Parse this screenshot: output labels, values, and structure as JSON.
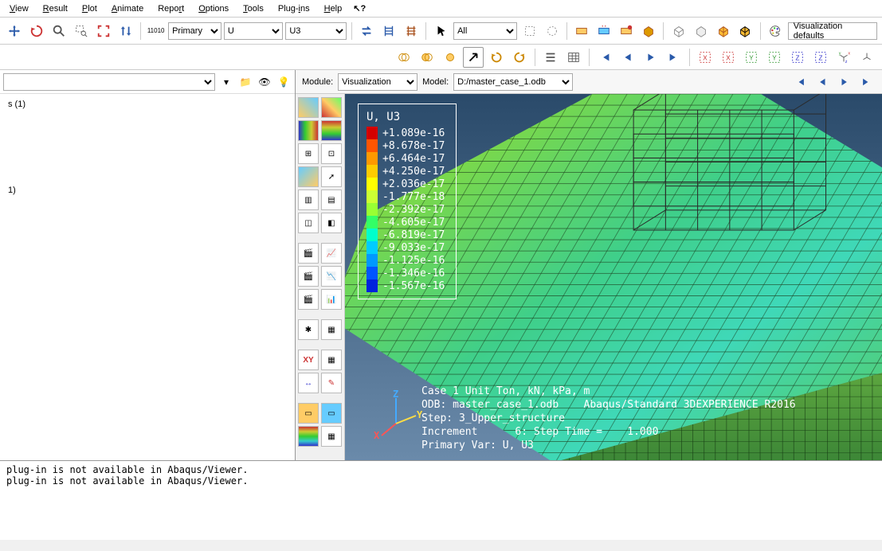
{
  "menu": {
    "items": [
      "View",
      "Result",
      "Plot",
      "Animate",
      "Report",
      "Options",
      "Tools",
      "Plug-ins",
      "Help"
    ]
  },
  "toolbar1": {
    "primary_label": "Primary",
    "var_select": "U",
    "component_select": "U3",
    "pick_select": "All",
    "viz_defaults": "Visualization defaults"
  },
  "context": {
    "module_label": "Module:",
    "module_value": "Visualization",
    "model_label": "Model:",
    "model_value": "D:/master_case_1.odb"
  },
  "tree": {
    "item0": "s (1)",
    "item1": "1)"
  },
  "legend": {
    "title": "U, U3",
    "colors": [
      "#d50000",
      "#ff5500",
      "#ff9900",
      "#ffcc00",
      "#ffff00",
      "#ccff33",
      "#99ff33",
      "#33ff66",
      "#00ffcc",
      "#00ccff",
      "#0099ff",
      "#0055ff",
      "#0022dd"
    ],
    "values": [
      "+1.089e-16",
      "+8.678e-17",
      "+6.464e-17",
      "+4.250e-17",
      "+2.036e-17",
      "-1.777e-18",
      "-2.392e-17",
      "-4.605e-17",
      "-6.819e-17",
      "-9.033e-17",
      "-1.125e-16",
      "-1.346e-16",
      "-1.567e-16"
    ]
  },
  "overlay": {
    "line0": "Case 1 Unit Ton, kN, kPa, m",
    "line1": "ODB: master_case_1.odb    Abaqus/Standard 3DEXPERIENCE R2016",
    "line2": "Step: 3_Upper_structure",
    "line3": "Increment      6: Step Time =    1.000",
    "line4": "Primary Var: U, U3"
  },
  "triad": {
    "x": "X",
    "y": "Y",
    "z": "Z"
  },
  "console": {
    "line0": "plug-in is not available in Abaqus/Viewer.",
    "line1": "plug-in is not available in Abaqus/Viewer."
  },
  "chart_data": {
    "type": "table",
    "title": "Contour legend: U, U3 (displacement component)",
    "series": [
      {
        "name": "U3",
        "values": [
          1.089e-16,
          8.678e-17,
          6.464e-17,
          4.25e-17,
          2.036e-17,
          -1.777e-18,
          -2.392e-17,
          -4.605e-17,
          -6.819e-17,
          -9.033e-17,
          -1.125e-16,
          -1.346e-16,
          -1.567e-16
        ]
      }
    ],
    "ylim": [
      -1.567e-16,
      1.089e-16
    ]
  }
}
